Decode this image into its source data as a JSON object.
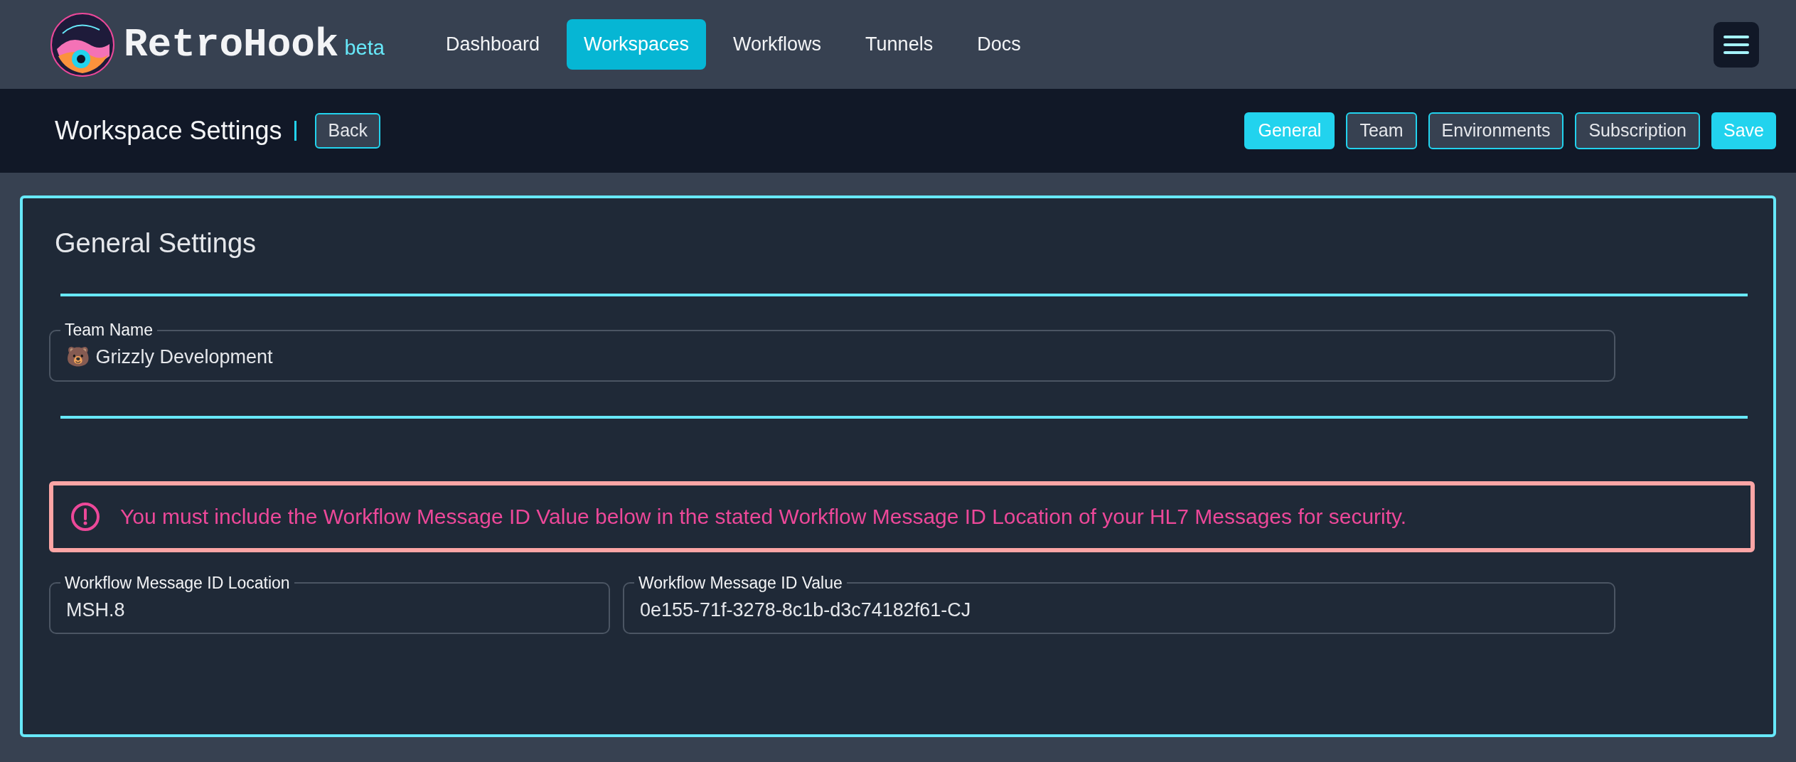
{
  "brand": {
    "name": "RetroHook",
    "badge": "beta"
  },
  "nav": [
    {
      "label": "Dashboard",
      "selected": false
    },
    {
      "label": "Workspaces",
      "selected": true
    },
    {
      "label": "Workflows",
      "selected": false
    },
    {
      "label": "Tunnels",
      "selected": false
    },
    {
      "label": "Docs",
      "selected": false
    }
  ],
  "subheader": {
    "title": "Workspace Settings",
    "back": "Back",
    "tabs": [
      {
        "label": "General",
        "selected": true
      },
      {
        "label": "Team",
        "selected": false
      },
      {
        "label": "Environments",
        "selected": false
      },
      {
        "label": "Subscription",
        "selected": false
      }
    ],
    "save": "Save"
  },
  "card": {
    "title": "General Settings",
    "team_name": {
      "label": "Team Name",
      "value": "🐻 Grizzly Development"
    },
    "alert": {
      "text": "You must include the Workflow Message ID Value below in the stated Workflow Message ID Location of your HL7 Messages for security."
    },
    "fields": [
      {
        "label": "Workflow Message ID Location",
        "value": "MSH.8"
      },
      {
        "label": "Workflow Message ID Value",
        "value": "0e155-71f-3278-8c1b-d3c74182f61-CJ"
      }
    ]
  }
}
